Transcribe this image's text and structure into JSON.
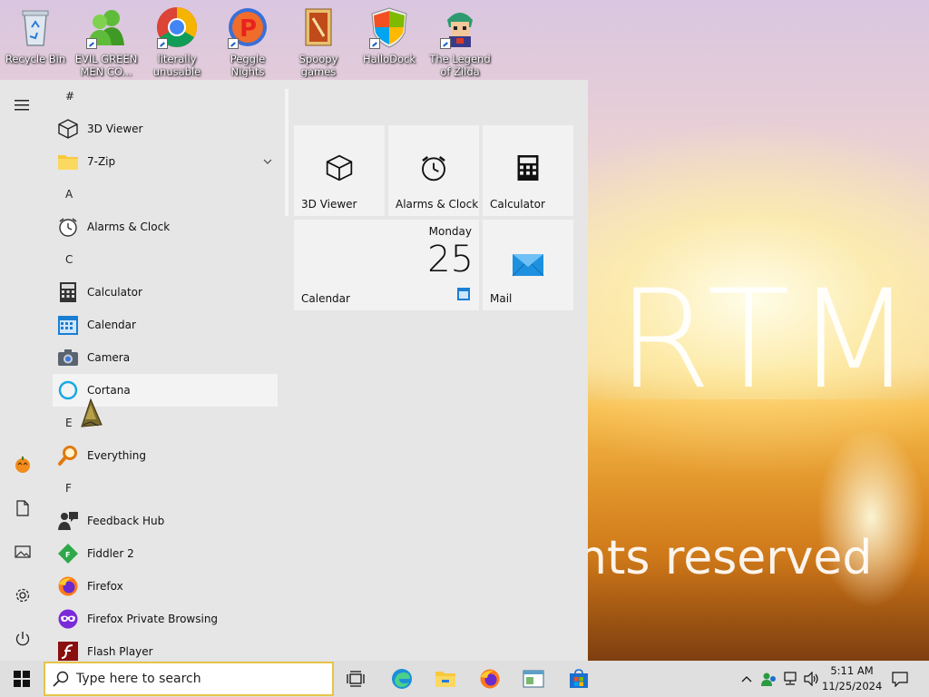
{
  "desktop": {
    "watermark_big": "RTM",
    "watermark_small": "nts reserved",
    "icons": [
      {
        "label": "Recycle Bin"
      },
      {
        "label": "EVIL GREEN MEN CO..."
      },
      {
        "label": "literally unusable"
      },
      {
        "label": "Peggle Nights Deluxe"
      },
      {
        "label": "Spoopy games"
      },
      {
        "label": "HalloDock"
      },
      {
        "label": "The Legend of Zilda"
      }
    ]
  },
  "start_menu": {
    "groups": [
      {
        "header": "#",
        "apps": [
          {
            "name": "3D Viewer",
            "icon": "cube-icon"
          },
          {
            "name": "7-Zip",
            "icon": "folder-icon",
            "expandable": true
          }
        ]
      },
      {
        "header": "A",
        "apps": [
          {
            "name": "Alarms & Clock",
            "icon": "alarm-clock-icon"
          }
        ]
      },
      {
        "header": "C",
        "apps": [
          {
            "name": "Calculator",
            "icon": "calculator-icon"
          },
          {
            "name": "Calendar",
            "icon": "calendar-icon"
          },
          {
            "name": "Camera",
            "icon": "camera-icon"
          },
          {
            "name": "Cortana",
            "icon": "cortana-ring-icon",
            "highlighted": true
          }
        ]
      },
      {
        "header": "E",
        "apps": [
          {
            "name": "Everything",
            "icon": "magnifier-icon"
          }
        ]
      },
      {
        "header": "F",
        "apps": [
          {
            "name": "Feedback Hub",
            "icon": "feedback-icon"
          },
          {
            "name": "Fiddler 2",
            "icon": "fiddler-icon"
          },
          {
            "name": "Firefox",
            "icon": "firefox-icon"
          },
          {
            "name": "Firefox Private Browsing",
            "icon": "firefox-private-icon"
          },
          {
            "name": "Flash Player",
            "icon": "flash-icon"
          }
        ]
      }
    ],
    "tiles": {
      "viewer": "3D Viewer",
      "alarms": "Alarms & Clock",
      "calculator": "Calculator",
      "calendar": "Calendar",
      "calendar_day": "Monday",
      "calendar_date": "25",
      "mail": "Mail"
    }
  },
  "taskbar": {
    "search_placeholder": "Type here to search",
    "time": "5:11 AM",
    "date": "11/25/2024"
  }
}
